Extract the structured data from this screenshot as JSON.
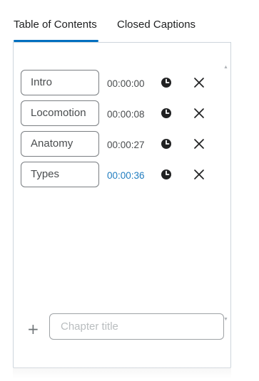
{
  "tabs": [
    {
      "label": "Table of Contents",
      "active": true
    },
    {
      "label": "Closed Captions",
      "active": false
    }
  ],
  "accent_color": "#006fbf",
  "chapters": [
    {
      "title": "Intro",
      "time": "00:00:00",
      "active": false
    },
    {
      "title": "Locomotion",
      "time": "00:00:08",
      "active": false
    },
    {
      "title": "Anatomy",
      "time": "00:00:27",
      "active": false
    },
    {
      "title": "Types",
      "time": "00:00:36",
      "active": true
    }
  ],
  "row_icons": {
    "set_time": "clock-icon",
    "delete": "close-icon"
  },
  "add_chapter": {
    "button_icon": "plus-icon",
    "placeholder": "Chapter title"
  }
}
